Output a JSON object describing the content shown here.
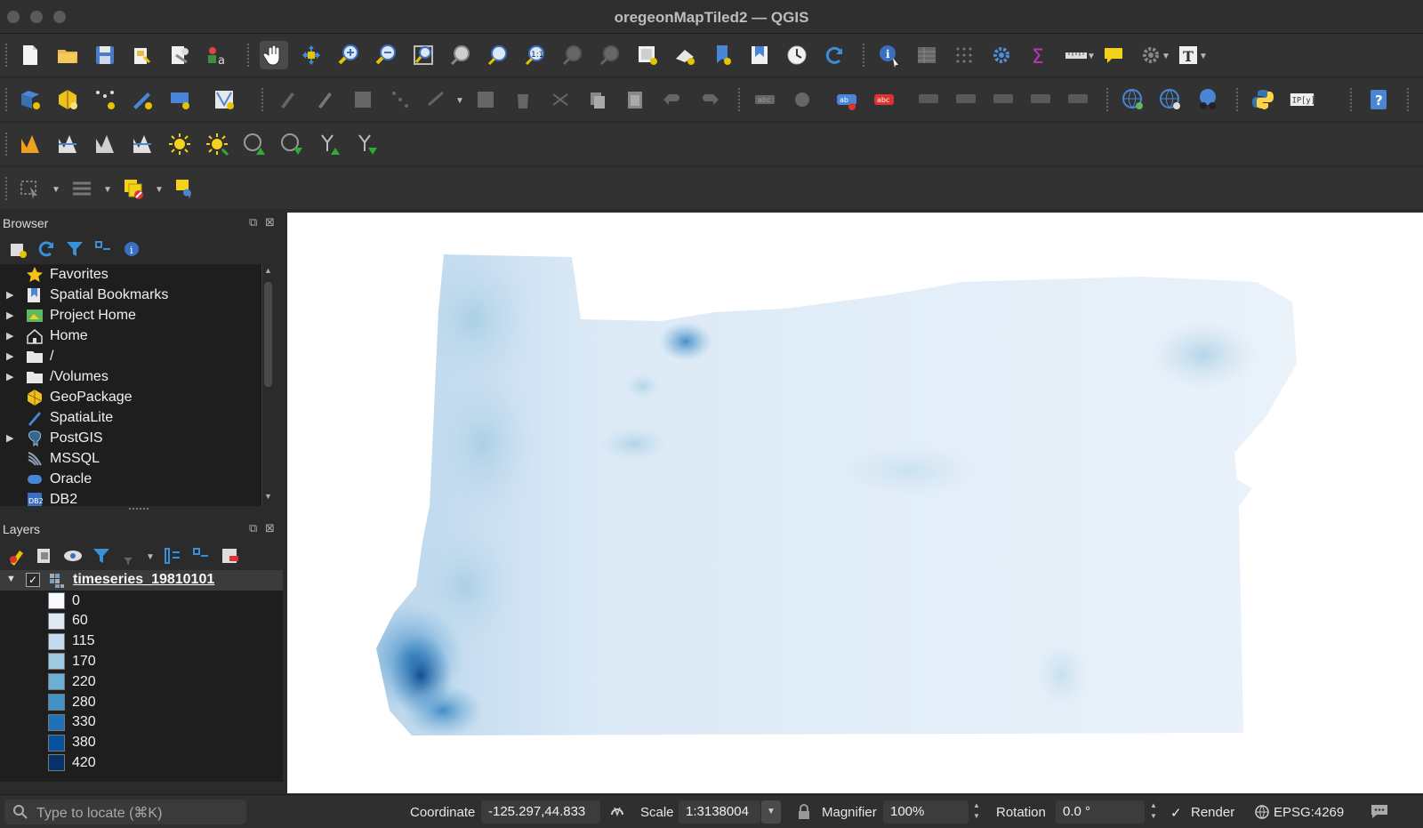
{
  "window": {
    "title": "oregeonMapTiled2 — QGIS"
  },
  "browser": {
    "title": "Browser",
    "items": [
      {
        "label": "Favorites",
        "icon": "star-icon",
        "expandable": false
      },
      {
        "label": "Spatial Bookmarks",
        "icon": "bookmark-icon",
        "expandable": true
      },
      {
        "label": "Project Home",
        "icon": "project-home-icon",
        "expandable": true
      },
      {
        "label": "Home",
        "icon": "home-icon",
        "expandable": true
      },
      {
        "label": "/",
        "icon": "folder-icon",
        "expandable": true
      },
      {
        "label": "/Volumes",
        "icon": "folder-icon",
        "expandable": true
      },
      {
        "label": "GeoPackage",
        "icon": "geopackage-icon",
        "expandable": false
      },
      {
        "label": "SpatiaLite",
        "icon": "spatialite-icon",
        "expandable": false
      },
      {
        "label": "PostGIS",
        "icon": "postgis-icon",
        "expandable": true
      },
      {
        "label": "MSSQL",
        "icon": "mssql-icon",
        "expandable": false
      },
      {
        "label": "Oracle",
        "icon": "oracle-icon",
        "expandable": false
      },
      {
        "label": "DB2",
        "icon": "db2-icon",
        "expandable": false
      }
    ]
  },
  "layers": {
    "title": "Layers",
    "layer_name": "timeseries_19810101",
    "checked": true,
    "legend": [
      {
        "label": "0",
        "color": "#f7fbff"
      },
      {
        "label": "60",
        "color": "#deebf7"
      },
      {
        "label": "115",
        "color": "#c6dbef"
      },
      {
        "label": "170",
        "color": "#9ecae1"
      },
      {
        "label": "220",
        "color": "#6baed6"
      },
      {
        "label": "280",
        "color": "#4292c6"
      },
      {
        "label": "330",
        "color": "#2171b5"
      },
      {
        "label": "380",
        "color": "#08519c"
      },
      {
        "label": "420",
        "color": "#08306b"
      }
    ]
  },
  "statusbar": {
    "locator_placeholder": "Type to locate (⌘K)",
    "coordinate_label": "Coordinate",
    "coordinate_value": "-125.297,44.833",
    "scale_label": "Scale",
    "scale_value": "1:3138004",
    "magnifier_label": "Magnifier",
    "magnifier_value": "100%",
    "rotation_label": "Rotation",
    "rotation_value": "0.0 °",
    "render_label": "Render",
    "render_checked": true,
    "crs_label": "EPSG:4269"
  }
}
